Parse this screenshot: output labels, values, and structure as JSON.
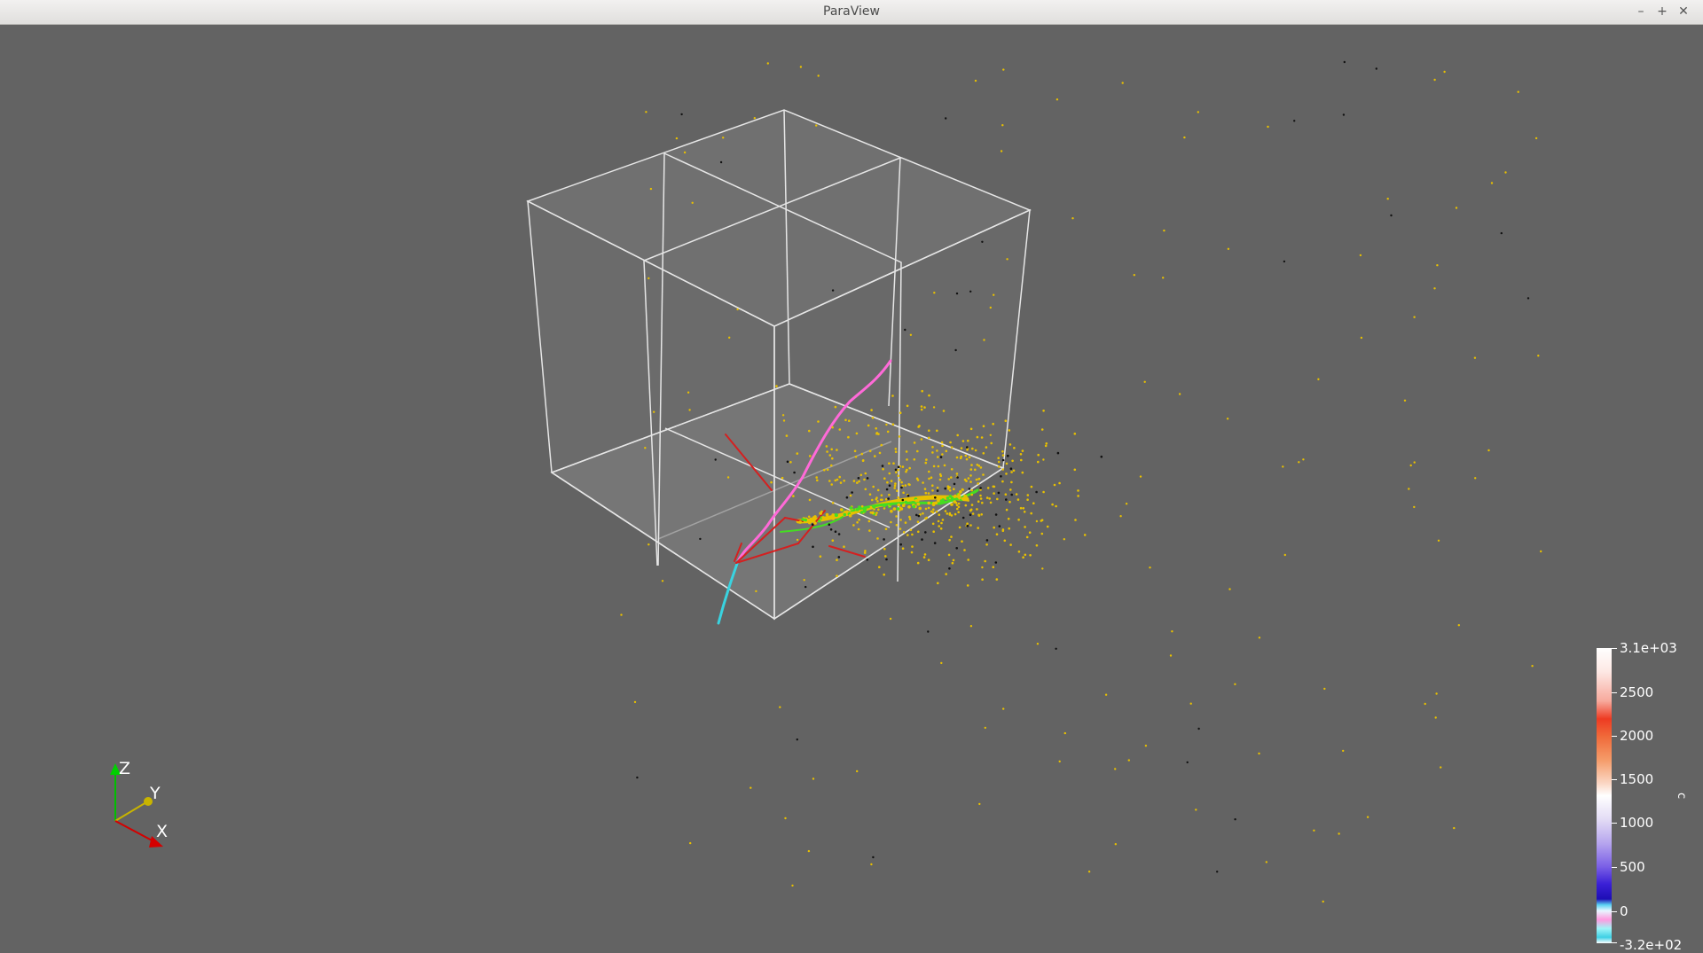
{
  "window": {
    "title": "ParaView",
    "minimize": "–",
    "maximize": "+",
    "close": "✕"
  },
  "orientation_axes": {
    "z_label": "Z",
    "y_label": "Y",
    "x_label": "X"
  },
  "color_legend": {
    "title": "c",
    "max_label": "3.1e+03",
    "min_label": "-3.2e+02",
    "ticks": [
      "2500",
      "2000",
      "1500",
      "1000",
      "500",
      "0"
    ]
  },
  "colors": {
    "background": "#636363",
    "box_edges": "#e8e8e8",
    "points_yellow": "#e8c000",
    "points_green": "#44dd22",
    "track_magenta": "#ff6ad8",
    "track_cyan": "#39d3e0",
    "track_red": "#d42020"
  }
}
